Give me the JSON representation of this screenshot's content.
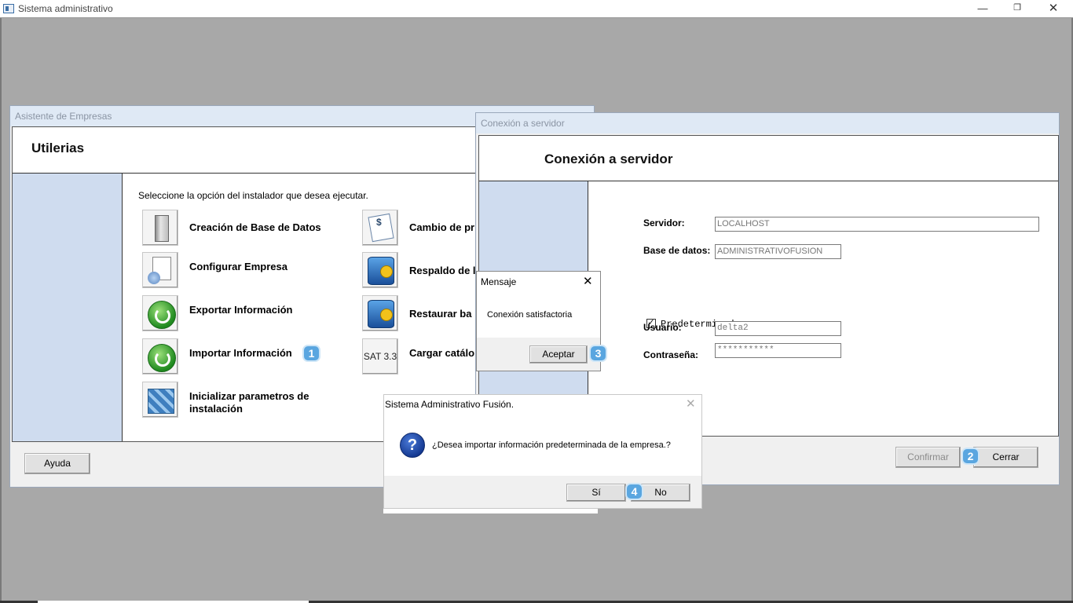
{
  "app": {
    "title": "Sistema administrativo",
    "controls": {
      "minimize": "—",
      "restore": "❐",
      "close": "✕"
    }
  },
  "asistente": {
    "title": "Asistente de Empresas",
    "header": "Utilerias",
    "instruction": "Seleccione la opción del instalador que desea ejecutar.",
    "options": [
      {
        "label": "Creación de Base de Datos",
        "icon": "database-server-icon"
      },
      {
        "label": "Configurar Empresa",
        "icon": "config-document-icon"
      },
      {
        "label": "Exportar Información",
        "icon": "export-arrow-icon"
      },
      {
        "label": "Importar Información",
        "icon": "import-arrow-icon"
      },
      {
        "label": "Inicializar parametros de instalación",
        "icon": "cubes-icon"
      },
      {
        "label": "Cambio de pr",
        "icon": "check-document-icon"
      },
      {
        "label": "Respaldo de l",
        "icon": "database-key-icon"
      },
      {
        "label": "Restaurar ba",
        "icon": "database-gear-icon"
      },
      {
        "label": "Cargar catálo",
        "icon": "sat-icon",
        "icon_text": "SAT 3.3"
      }
    ],
    "help_button": "Ayuda"
  },
  "conexion": {
    "title": "Conexión a servidor",
    "header": "Conexión a servidor",
    "servidor_label": "Servidor:",
    "servidor_value": "LOCALHOST",
    "base_label": "Base de datos:",
    "base_value": "ADMINISTRATIVOFUSION",
    "predeterminado_label": "Predeterminado",
    "predeterminado_checked": true,
    "usuario_label": "Usuario:",
    "usuario_value": "delta2",
    "contrasena_label": "Contraseña:",
    "contrasena_value": "***********",
    "confirm_button": "Confirmar",
    "close_button": "Cerrar"
  },
  "mensaje": {
    "title": "Mensaje",
    "text": "Conexión satisfactoria",
    "ok_button": "Aceptar",
    "close_glyph": "✕"
  },
  "sistema_dialog": {
    "title": "Sistema Administrativo Fusión.",
    "question": "¿Desea importar información predeterminada de la empresa.?",
    "yes_button": "Sí",
    "no_button": "No",
    "close_glyph": "✕",
    "icon": "question-icon",
    "icon_glyph": "?"
  },
  "badges": [
    "1",
    "2",
    "3",
    "4"
  ],
  "colors": {
    "sidebar": "#cfdcef",
    "badge": "#5aa6e0",
    "titlebar": "#dfe9f5"
  }
}
